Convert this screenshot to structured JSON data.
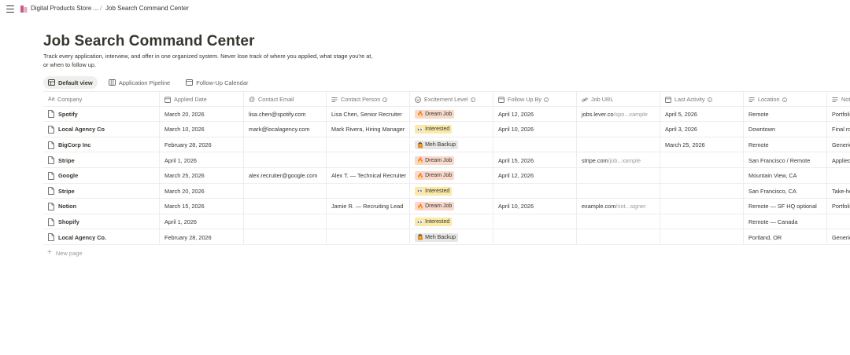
{
  "breadcrumb": {
    "workspace": "Digital Products Store ...",
    "separator": "/",
    "page": "Job Search Command Center"
  },
  "page": {
    "title": "Job Search Command Center",
    "description": "Track every application, interview, and offer in one organized system. Never lose track of where you applied, what stage you're at, or when to follow up."
  },
  "views": [
    "Default view",
    "Application Pipeline",
    "Follow-Up Calendar"
  ],
  "columns": [
    "Company",
    "Applied Date",
    "Contact Email",
    "Contact Person",
    "Excitement Level",
    "Follow Up By",
    "Job URL",
    "Last Activity",
    "Location",
    "Not"
  ],
  "rows": [
    {
      "company": "Spotify",
      "applied": "March 20, 2026",
      "email": "lisa.chen@spotify.com",
      "person": "Lisa Chen, Senior Recruiter",
      "excitement": "Dream Job",
      "level": "dream",
      "followup": "April 12, 2026",
      "url_a": "jobs.lever.co",
      "url_b": "/spo...xample",
      "last": "April 5, 2026",
      "location": "Remote",
      "notes": "Portfolio"
    },
    {
      "company": "Local Agency Co",
      "applied": "March 10, 2026",
      "email": "mark@localagency.com",
      "person": "Mark Rivera, Hiring Manager",
      "excitement": "Interested",
      "level": "interested",
      "followup": "April 10, 2026",
      "url_a": "",
      "url_b": "",
      "last": "April 3, 2026",
      "location": "Downtown",
      "notes": "Final ro"
    },
    {
      "company": "BigCorp Inc",
      "applied": "February 28, 2026",
      "email": "",
      "person": "",
      "excitement": "Meh Backup",
      "level": "meh",
      "followup": "",
      "url_a": "",
      "url_b": "",
      "last": "March 25, 2026",
      "location": "Remote",
      "notes": "Generic"
    },
    {
      "company": "Stripe",
      "applied": "April 1, 2026",
      "email": "",
      "person": "",
      "excitement": "Dream Job",
      "level": "dream",
      "followup": "April 15, 2026",
      "url_a": "stripe.com",
      "url_b": "/job...xample",
      "last": "",
      "location": "San Francisco / Remote",
      "notes": "Applied"
    },
    {
      "company": "Google",
      "applied": "March 25, 2026",
      "email": "alex.recruiter@google.com",
      "person": "Alex T. — Technical Recruiter",
      "excitement": "Dream Job",
      "level": "dream",
      "followup": "April 12, 2026",
      "url_a": "",
      "url_b": "",
      "last": "",
      "location": "Mountain View, CA",
      "notes": ""
    },
    {
      "company": "Stripe",
      "applied": "March 20, 2026",
      "email": "",
      "person": "",
      "excitement": "Interested",
      "level": "interested",
      "followup": "",
      "url_a": "",
      "url_b": "",
      "last": "",
      "location": "San Francisco, CA",
      "notes": "Take-ho"
    },
    {
      "company": "Notion",
      "applied": "March 15, 2026",
      "email": "",
      "person": "Jamie R. — Recruiting Lead",
      "excitement": "Dream Job",
      "level": "dream",
      "followup": "April 10, 2026",
      "url_a": "example.com",
      "url_b": "/not...signer",
      "last": "",
      "location": "Remote — SF HQ optional",
      "notes": "Portfolio"
    },
    {
      "company": "Shopify",
      "applied": "April 1, 2026",
      "email": "",
      "person": "",
      "excitement": "Interested",
      "level": "interested",
      "followup": "",
      "url_a": "",
      "url_b": "",
      "last": "",
      "location": "Remote — Canada",
      "notes": ""
    },
    {
      "company": "Local Agency Co.",
      "applied": "February 28, 2026",
      "email": "",
      "person": "",
      "excitement": "Meh Backup",
      "level": "meh",
      "followup": "",
      "url_a": "",
      "url_b": "",
      "last": "",
      "location": "Portland, OR",
      "notes": "Generic"
    }
  ],
  "excitement_emoji": {
    "dream": "🔥",
    "interested": "👀",
    "meh": "🤷"
  },
  "new_page_label": "New page",
  "colors": {
    "dream": "#f8d9cc",
    "interested": "#fbe9a8",
    "meh": "#e6e6e4",
    "text": "#37352f",
    "muted": "#787774"
  }
}
